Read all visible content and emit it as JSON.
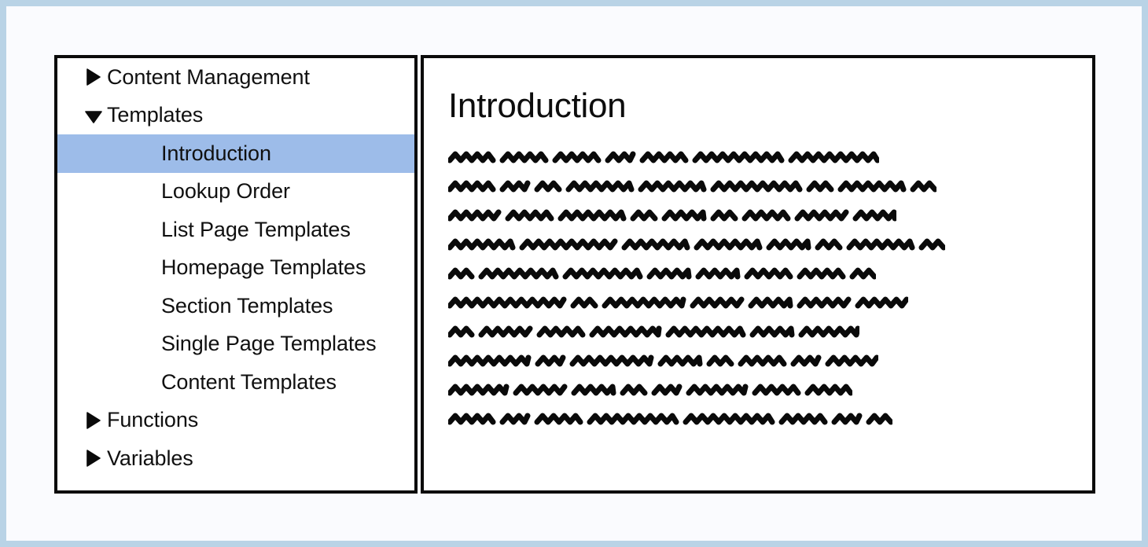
{
  "frame": {
    "border_color": "#b9d3e6",
    "page_background": "#fafbfe",
    "panel_border_color": "#0a0a0a"
  },
  "sidebar": {
    "name": "documentation-navigation-tree",
    "selection_color": "#9dbce9",
    "items": [
      {
        "label": "Content Management",
        "level": 0,
        "icon": "caret-right-icon",
        "expanded": false,
        "selected": false
      },
      {
        "label": "Templates",
        "level": 0,
        "icon": "caret-down-icon",
        "expanded": true,
        "selected": false
      },
      {
        "label": "Introduction",
        "level": 1,
        "icon": "none",
        "expanded": false,
        "selected": true
      },
      {
        "label": "Lookup Order",
        "level": 1,
        "icon": "none",
        "expanded": false,
        "selected": false
      },
      {
        "label": "List Page Templates",
        "level": 1,
        "icon": "none",
        "expanded": false,
        "selected": false
      },
      {
        "label": "Homepage Templates",
        "level": 1,
        "icon": "none",
        "expanded": false,
        "selected": false
      },
      {
        "label": "Section Templates",
        "level": 1,
        "icon": "none",
        "expanded": false,
        "selected": false
      },
      {
        "label": "Single Page Templates",
        "level": 1,
        "icon": "none",
        "expanded": false,
        "selected": false
      },
      {
        "label": "Content Templates",
        "level": 1,
        "icon": "none",
        "expanded": false,
        "selected": false
      },
      {
        "label": "Functions",
        "level": 0,
        "icon": "caret-right-icon",
        "expanded": false,
        "selected": false
      },
      {
        "label": "Variables",
        "level": 0,
        "icon": "caret-right-icon",
        "expanded": false,
        "selected": false
      }
    ]
  },
  "content": {
    "title": "Introduction",
    "body_style": "greeked-scribble-placeholder",
    "body_color": "#0a0a0a",
    "body_lines": [
      [
        55,
        55,
        55,
        32,
        55,
        110,
        110
      ],
      [
        55,
        32,
        28,
        80,
        80,
        110,
        28,
        80,
        28
      ],
      [
        62,
        55,
        80,
        28,
        50,
        28,
        55,
        62,
        50
      ],
      [
        80,
        118,
        80,
        80,
        50,
        28,
        80,
        28
      ],
      [
        28,
        95,
        95,
        50,
        50,
        55,
        55,
        28
      ],
      [
        145,
        28,
        100,
        62,
        50,
        62,
        62
      ],
      [
        28,
        62,
        55,
        85,
        95,
        50,
        72
      ],
      [
        100,
        32,
        100,
        50,
        28,
        55,
        32,
        62
      ],
      [
        72,
        62,
        50,
        28,
        32,
        72,
        55,
        55
      ],
      [
        55,
        32,
        55,
        110,
        110,
        55,
        32,
        28
      ]
    ]
  }
}
